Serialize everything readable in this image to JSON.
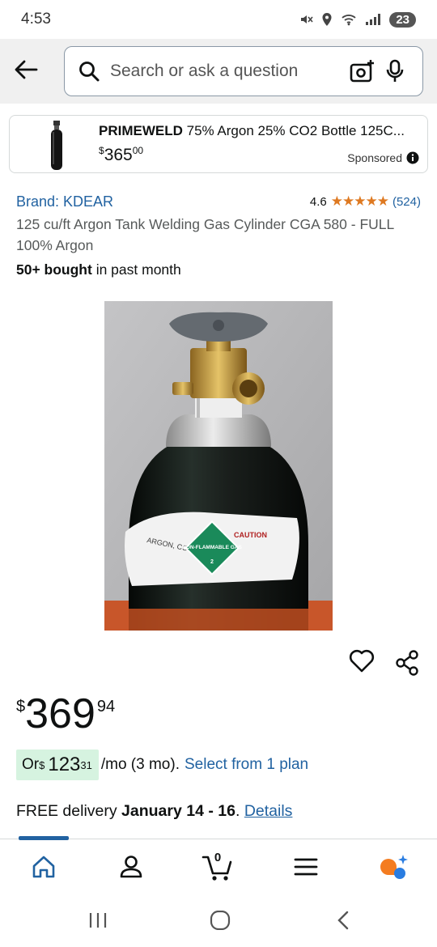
{
  "status_bar": {
    "time": "4:53",
    "battery": "23"
  },
  "search": {
    "placeholder": "Search or ask a question"
  },
  "sponsored": {
    "brand": "PRIMEWELD",
    "title": "75% Argon 25% CO2 Bottle 125C...",
    "price_currency": "$",
    "price_whole": "365",
    "price_fraction": "00",
    "label": "Sponsored"
  },
  "product": {
    "brand": "Brand: KDEAR",
    "rating": "4.6",
    "stars": "★★★★★",
    "review_count": "(524)",
    "title": "125 cu/ft Argon Tank Welding Gas Cylinder CGA 580 - FULL 100% Argon",
    "bought_bold": "50+ bought",
    "bought_rest": " in past month",
    "image_label_argon": "ARGON, COMPRESSED",
    "image_label_caution": "CAUTION",
    "image_label_diamond": "NON-FLAMMABLE GAS",
    "image_label_class": "2"
  },
  "price": {
    "currency": "$",
    "whole": "369",
    "fraction": "94"
  },
  "installment": {
    "prefix": "Or ",
    "currency": "$",
    "whole": "123",
    "fraction": "31",
    "period": "/mo (3 mo).",
    "plan_link": "Select from 1 plan"
  },
  "delivery": {
    "prefix": "FREE delivery ",
    "dates": "January 14 - 16",
    "separator": ". ",
    "details_link": "Details"
  },
  "bottom_nav": {
    "cart_count": "0"
  },
  "colors": {
    "link": "#2162a1",
    "star": "#de7921",
    "installment_bg": "#d6f3e0",
    "header_bg": "#f0f0f0"
  }
}
